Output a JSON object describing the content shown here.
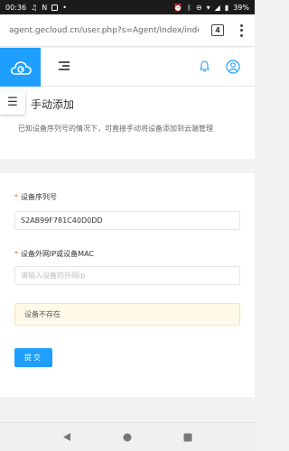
{
  "statusbar": {
    "time": "00:36",
    "battery": "39%",
    "left_icons": [
      "ring-icon",
      "notification-n-icon",
      "mail-icon",
      "dot-icon"
    ],
    "right_icons": [
      "alarm-icon",
      "bluetooth-icon",
      "minus-circle-icon",
      "wifi-icon",
      "signal-icon",
      "battery-icon"
    ]
  },
  "browser": {
    "url": "agent.gecloud.cn/user.php?s=Agent/Index/index/",
    "tab_count": "4",
    "menu_icon": "more-vert-icon"
  },
  "header": {
    "logo_icon": "cloud-logo-icon",
    "menu_icon": "hamburger-icon",
    "bell_icon": "bell-icon",
    "user_icon": "user-circle-icon",
    "accent_color": "#1e9fff"
  },
  "page": {
    "side_toggle": "☰",
    "title": "手动添加",
    "description": "已知设备序列号的情况下，可直接手动将设备添加到云端管理"
  },
  "form": {
    "serial_label": "设备序列号",
    "serial_value": "S2AB99F781C40D0DD",
    "mac_label": "设备外网IP或设备MAC",
    "mac_placeholder": "请输入设备的外网ip",
    "required_mark": "*",
    "alert_text": "设备不存在",
    "submit_label": "提交"
  },
  "navbar": {
    "back_icon": "back-triangle-icon",
    "home_icon": "home-circle-icon",
    "recents_icon": "recents-square-icon"
  }
}
